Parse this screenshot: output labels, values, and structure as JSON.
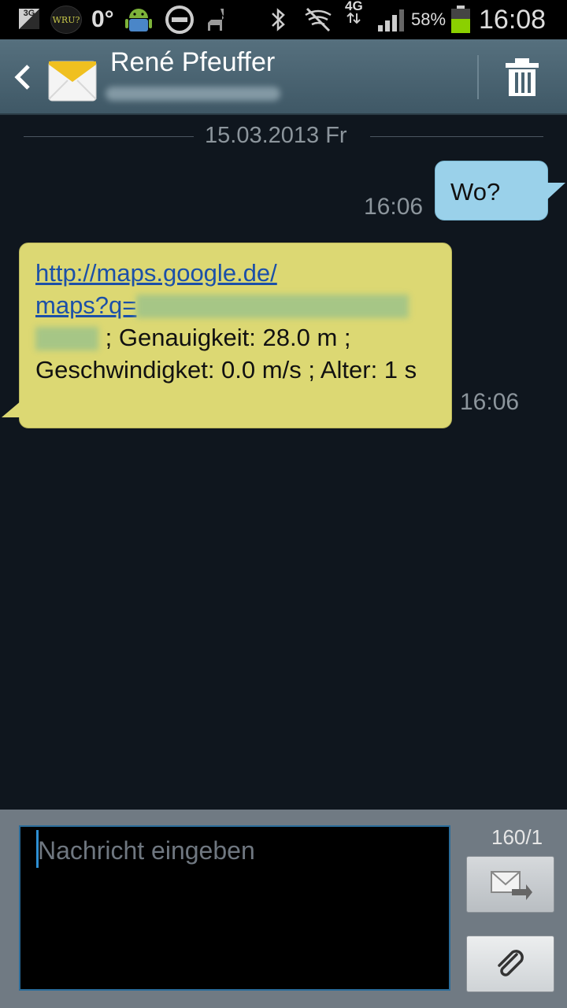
{
  "status_bar": {
    "network_badge": "3G",
    "app_badge": "WRU?",
    "temperature": "0°",
    "network_type": "4G",
    "battery_percent": "58%",
    "battery_level": 0.58,
    "time": "16:08",
    "icons": [
      "3g-icon",
      "wru-icon",
      "android-icon",
      "do-not-disturb-icon",
      "llama-icon",
      "bluetooth-icon",
      "no-signal-icon",
      "signal-bars-icon",
      "battery-icon"
    ]
  },
  "header": {
    "contact_name": "René Pfeuffer",
    "colors": {
      "bar": "#4a6472"
    }
  },
  "conversation": {
    "date_separator": "15.03.2013 Fr",
    "messages": [
      {
        "direction": "outgoing",
        "text": "Wo?",
        "time": "16:06",
        "bubble_color": "#9ad1ea"
      },
      {
        "direction": "incoming",
        "link_line1": "http://maps.google.de/",
        "link_line2": "maps?q=",
        "text_after_link": "; Genauigkeit: 28.0 m ; Geschwindigket: 0.0 m/s ; Alter: 1 s",
        "time": "16:06",
        "bubble_color": "#dcd873"
      }
    ]
  },
  "composer": {
    "placeholder": "Nachricht eingeben",
    "counter": "160/1",
    "icons": [
      "send-icon",
      "paperclip-icon"
    ]
  }
}
